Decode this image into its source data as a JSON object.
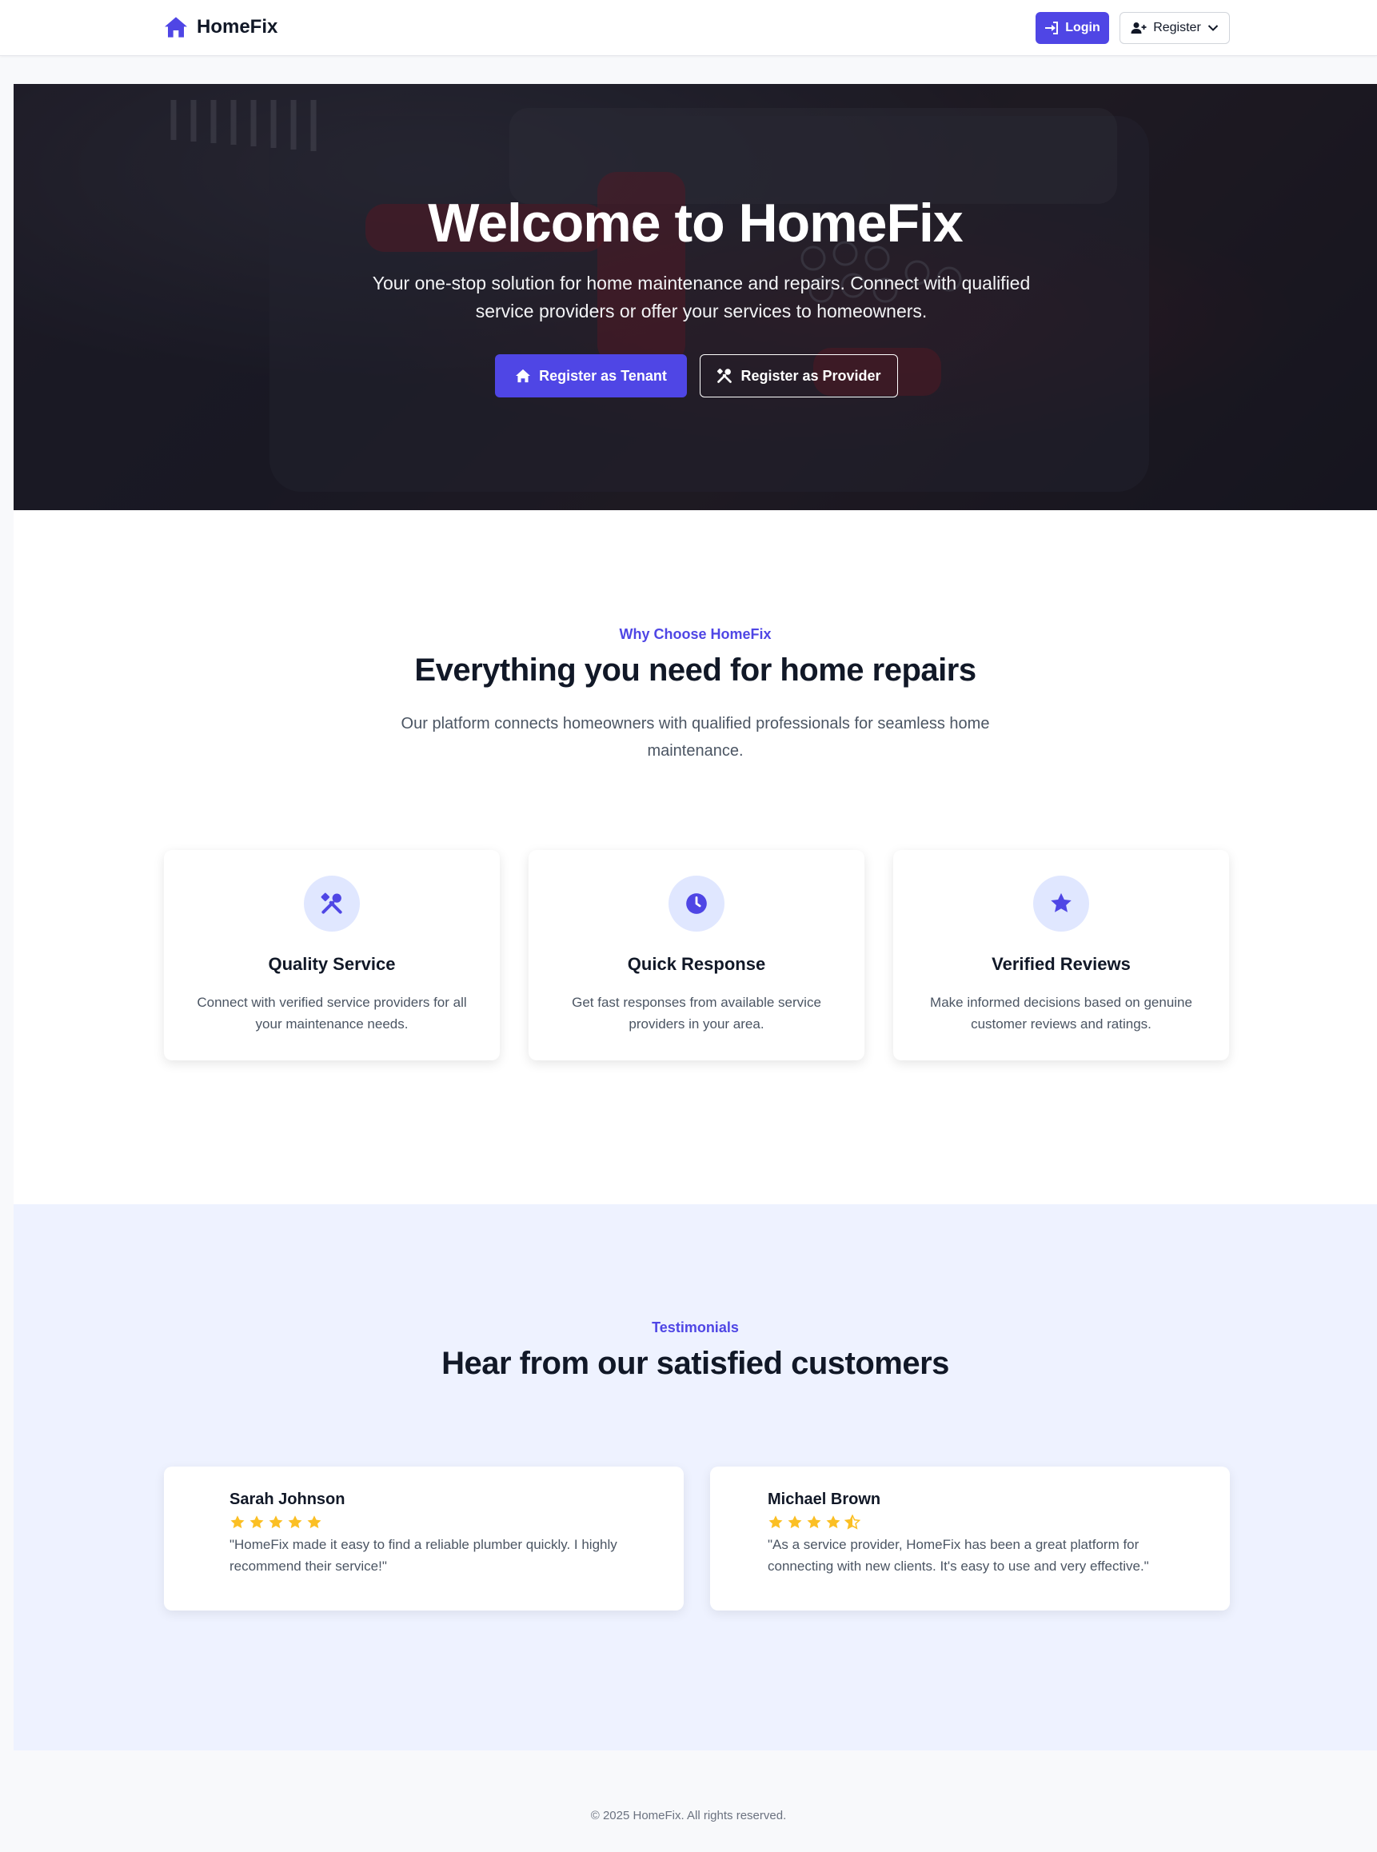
{
  "nav": {
    "brand_name": "HomeFix",
    "brand_icon": "house-icon",
    "login_label": "Login",
    "register_label": "Register",
    "accent_color": "#4f46e5"
  },
  "hero": {
    "title": "Welcome to HomeFix",
    "subtitle": "Your one-stop solution for home maintenance and repairs. Connect with qualified service providers or offer your services to homeowners.",
    "tenant_button": "Register as Tenant",
    "provider_button": "Register as Provider"
  },
  "features": {
    "eyebrow": "Why Choose HomeFix",
    "title": "Everything you need for home repairs",
    "description": "Our platform connects homeowners with qualified professionals for seamless home maintenance.",
    "cards": [
      {
        "icon": "tools-icon",
        "title": "Quality Service",
        "description": "Connect with verified service providers for all your maintenance needs."
      },
      {
        "icon": "clock-icon",
        "title": "Quick Response",
        "description": "Get fast responses from available service providers in your area."
      },
      {
        "icon": "star-icon",
        "title": "Verified Reviews",
        "description": "Make informed decisions based on genuine customer reviews and ratings."
      }
    ]
  },
  "testimonials": {
    "eyebrow": "Testimonials",
    "title": "Hear from our satisfied customers",
    "items": [
      {
        "name": "Sarah Johnson",
        "rating": 5,
        "quote": "\"HomeFix made it easy to find a reliable plumber quickly. I highly recommend their service!\""
      },
      {
        "name": "Michael Brown",
        "rating": 4.5,
        "quote": "\"As a service provider, HomeFix has been a great platform for connecting with new clients. It's easy to use and very effective.\""
      }
    ],
    "star_color": "#fbbf24"
  },
  "footer": {
    "text": "© 2025 HomeFix. All rights reserved."
  }
}
